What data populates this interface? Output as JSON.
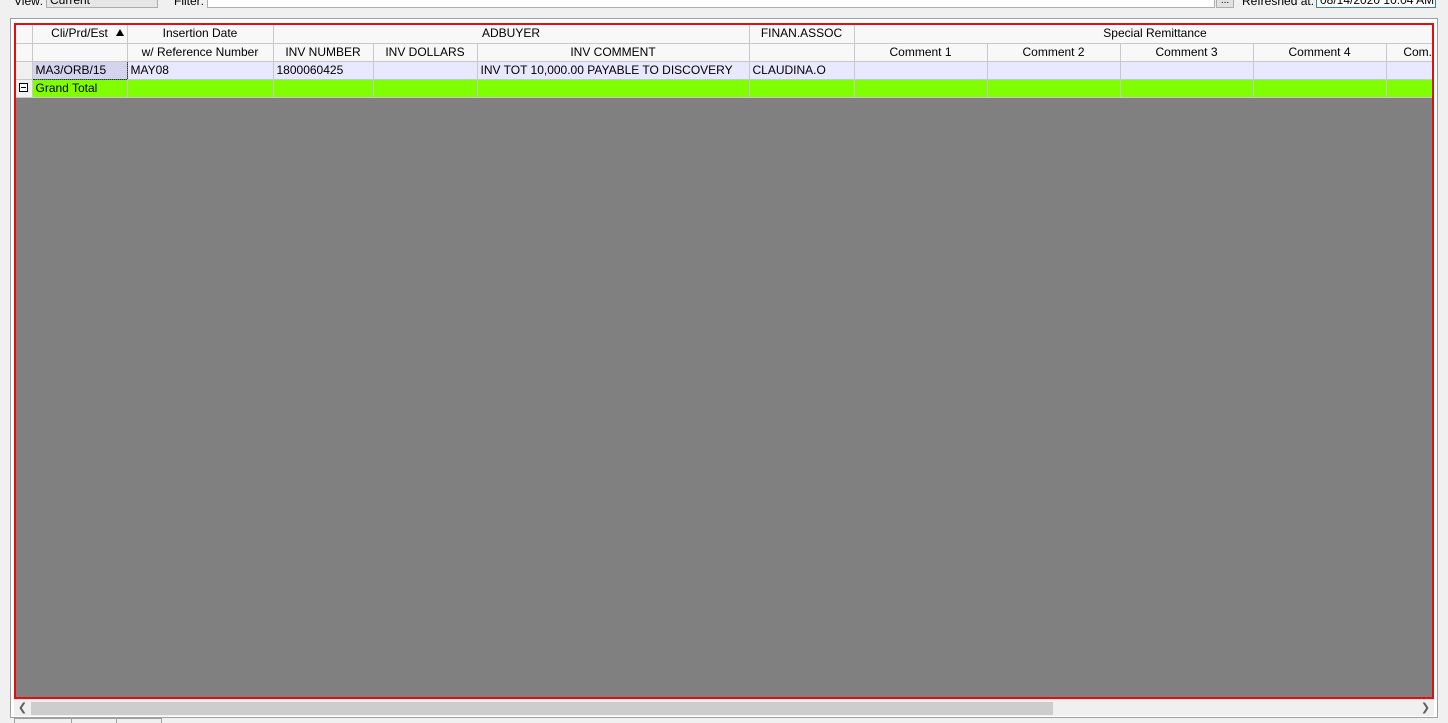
{
  "toolbar": {
    "view_label": "View:",
    "view_value": "Current",
    "filter_label": "Filter:",
    "ellipsis": "...",
    "refreshed_label": "Refreshed at:",
    "refreshed_value": "08/14/2020 10:04 AM"
  },
  "grid": {
    "header_row1": {
      "cli_prd_est": "Cli/Prd/Est",
      "insertion_date": "Insertion Date",
      "adbuyer": "ADBUYER",
      "finan_assoc": "FINAN.ASSOC",
      "special_remittance": "Special Remittance"
    },
    "header_row2": {
      "ref_number": "w/ Reference Number",
      "inv_number": "INV NUMBER",
      "inv_dollars": "INV DOLLARS",
      "inv_comment": "INV COMMENT",
      "comment1": "Comment 1",
      "comment2": "Comment 2",
      "comment3": "Comment 3",
      "comment4": "Comment 4",
      "comment5": "Com..."
    },
    "rows": [
      {
        "cli_prd_est": "MA3/ORB/15",
        "insertion_date": "MAY08",
        "inv_number": "1800060425",
        "inv_dollars": "",
        "inv_comment": "INV TOT 10,000.00 PAYABLE TO DISCOVERY",
        "finan_assoc": "CLAUDINA.O"
      }
    ],
    "total_label": "Grand Total"
  },
  "colors": {
    "frame_border": "#e01010",
    "grid_background": "#808080",
    "data_row": "#e8e8ff",
    "total_row": "#80ff00"
  },
  "icons": {
    "sort": "sort-ascending-icon",
    "collapse": "collapse-minus-icon",
    "scroll_left": "chevron-left-icon",
    "scroll_right": "chevron-right-icon"
  }
}
